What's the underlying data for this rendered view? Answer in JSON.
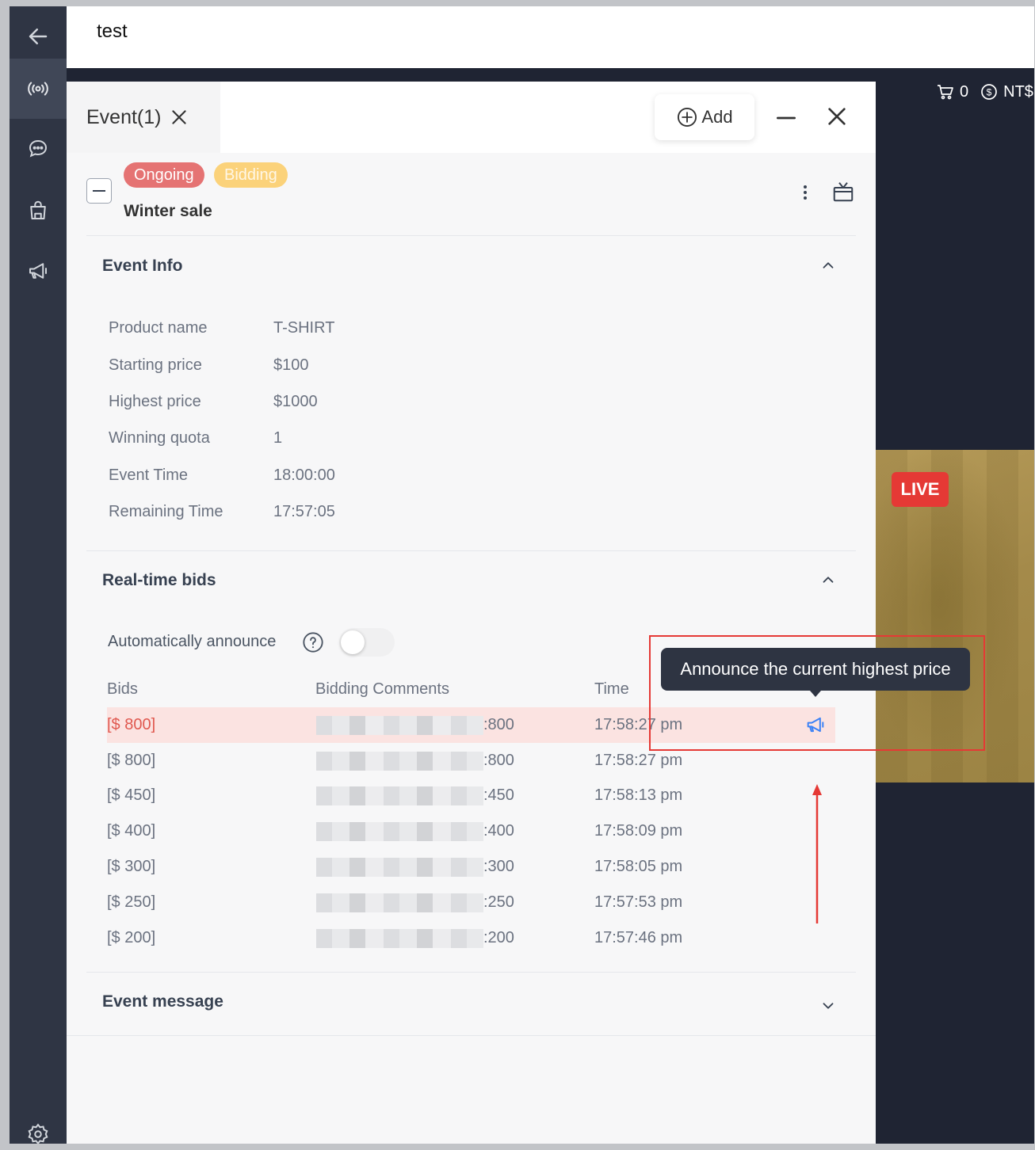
{
  "topbar": {
    "title": "test"
  },
  "stage": {
    "cart_count": "0",
    "currency": "NT$",
    "live_badge": "LIVE"
  },
  "panel": {
    "tab_label": "Event(1)",
    "add_label": "Add"
  },
  "event": {
    "status_badge": "Ongoing",
    "type_badge": "Bidding",
    "name": "Winter sale"
  },
  "event_info": {
    "title": "Event Info",
    "rows": [
      {
        "label": "Product name",
        "value": "T-SHIRT"
      },
      {
        "label": "Starting price",
        "value": "$100"
      },
      {
        "label": "Highest price",
        "value": "$1000"
      },
      {
        "label": "Winning quota",
        "value": "1"
      },
      {
        "label": "Event Time",
        "value": "18:00:00"
      },
      {
        "label": "Remaining Time",
        "value": "17:57:05"
      }
    ]
  },
  "bids": {
    "title": "Real-time bids",
    "auto_announce_label": "Automatically announce",
    "auto_announce_enabled": false,
    "headers": {
      "bids": "Bids",
      "comments": "Bidding Comments",
      "time": "Time"
    },
    "rows": [
      {
        "bid": "[$ 800]",
        "comment_suffix": ":800",
        "time": "17:58:27 pm",
        "highlighted": true
      },
      {
        "bid": "[$ 800]",
        "comment_suffix": ":800",
        "time": "17:58:27 pm"
      },
      {
        "bid": "[$ 450]",
        "comment_suffix": ":450",
        "time": "17:58:13 pm"
      },
      {
        "bid": "[$ 400]",
        "comment_suffix": ":400",
        "time": "17:58:09 pm"
      },
      {
        "bid": "[$ 300]",
        "comment_suffix": ":300",
        "time": "17:58:05 pm"
      },
      {
        "bid": "[$ 250]",
        "comment_suffix": ":250",
        "time": "17:57:53 pm"
      },
      {
        "bid": "[$ 200]",
        "comment_suffix": ":200",
        "time": "17:57:46 pm"
      }
    ],
    "tooltip": "Announce the current highest price"
  },
  "event_message": {
    "title": "Event message"
  },
  "colors": {
    "accent_red": "#e53935",
    "ongoing": "#e57373",
    "bidding": "#fbd27a",
    "announce_blue": "#3b82f6"
  }
}
